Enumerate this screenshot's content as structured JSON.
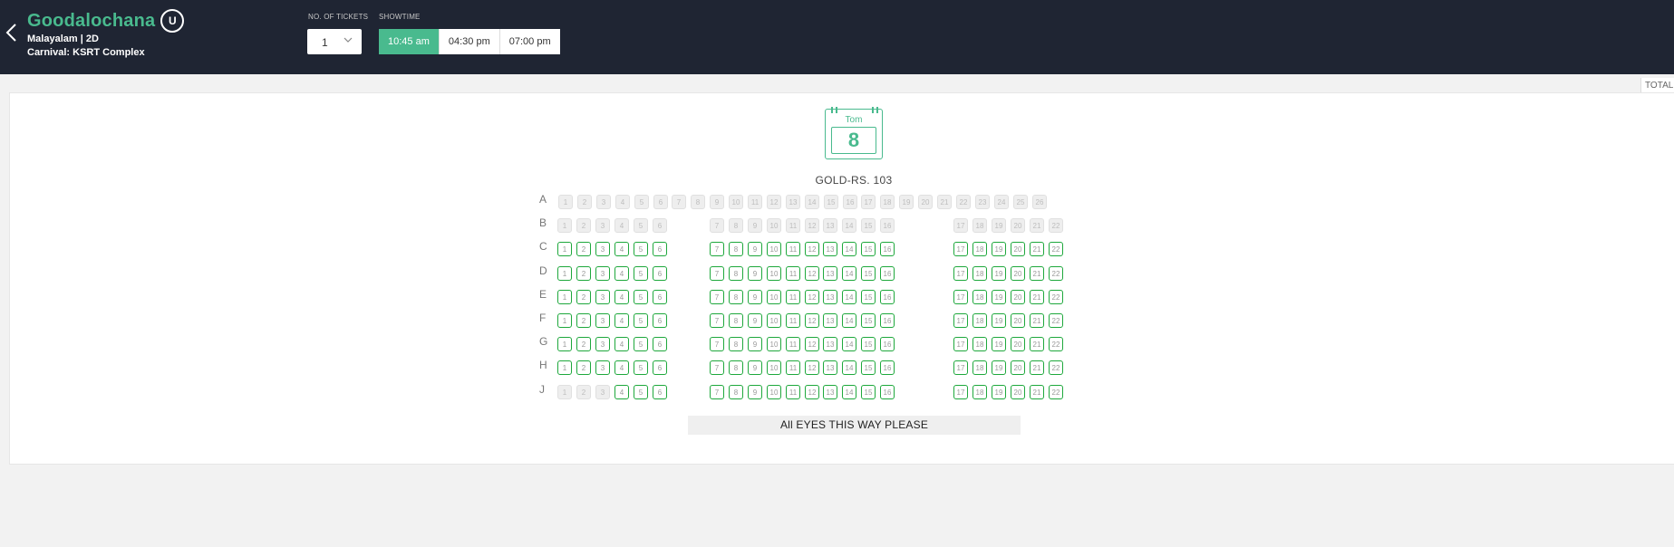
{
  "header": {
    "movie_title": "Goodalochana",
    "certificate": "U",
    "language_format": "Malayalam | 2D",
    "cinema": "Carnival: KSRT Complex",
    "tickets_label": "NO. OF TICKETS",
    "tickets_value": "1",
    "showtime_label": "SHOWTIME",
    "showtimes": [
      {
        "label": "10:45 am",
        "active": true
      },
      {
        "label": "04:30 pm",
        "active": false
      },
      {
        "label": "07:00 pm",
        "active": false
      }
    ]
  },
  "total_label": "TOTAL",
  "date": {
    "day": "Tom",
    "number": "8"
  },
  "category": "GOLD-RS. 103",
  "screen_text": "All EYES THIS WAY PLEASE",
  "colors": {
    "header_bg": "#1f2533",
    "accent": "#49ba8e",
    "available_border": "#1ea83c",
    "sold_bg": "#eeeeee"
  },
  "rows": [
    {
      "label": "A",
      "layout": "continuous",
      "seats": 26,
      "available": []
    },
    {
      "label": "B",
      "layout": "blocks",
      "seats": 22,
      "available": []
    },
    {
      "label": "C",
      "layout": "blocks",
      "seats": 22,
      "available": [
        1,
        2,
        3,
        4,
        5,
        6,
        7,
        8,
        9,
        10,
        11,
        12,
        13,
        14,
        15,
        16,
        17,
        18,
        19,
        20,
        21,
        22
      ]
    },
    {
      "label": "D",
      "layout": "blocks",
      "seats": 22,
      "available": [
        1,
        2,
        3,
        4,
        5,
        6,
        7,
        8,
        9,
        10,
        11,
        12,
        13,
        14,
        15,
        16,
        17,
        18,
        19,
        20,
        21,
        22
      ]
    },
    {
      "label": "E",
      "layout": "blocks",
      "seats": 22,
      "available": [
        1,
        2,
        3,
        4,
        5,
        6,
        7,
        8,
        9,
        10,
        11,
        12,
        13,
        14,
        15,
        16,
        17,
        18,
        19,
        20,
        21,
        22
      ]
    },
    {
      "label": "F",
      "layout": "blocks",
      "seats": 22,
      "available": [
        1,
        2,
        3,
        4,
        5,
        6,
        7,
        8,
        9,
        10,
        11,
        12,
        13,
        14,
        15,
        16,
        17,
        18,
        19,
        20,
        21,
        22
      ]
    },
    {
      "label": "G",
      "layout": "blocks",
      "seats": 22,
      "available": [
        1,
        2,
        3,
        4,
        5,
        6,
        7,
        8,
        9,
        10,
        11,
        12,
        13,
        14,
        15,
        16,
        17,
        18,
        19,
        20,
        21,
        22
      ]
    },
    {
      "label": "H",
      "layout": "blocks",
      "seats": 22,
      "available": [
        1,
        2,
        3,
        4,
        5,
        6,
        7,
        8,
        9,
        10,
        11,
        12,
        13,
        14,
        15,
        16,
        17,
        18,
        19,
        20,
        21,
        22
      ]
    },
    {
      "label": "J",
      "layout": "blocks",
      "seats": 22,
      "available": [
        4,
        5,
        6,
        7,
        8,
        9,
        10,
        11,
        12,
        13,
        14,
        15,
        16,
        17,
        18,
        19,
        20,
        21,
        22
      ]
    }
  ]
}
